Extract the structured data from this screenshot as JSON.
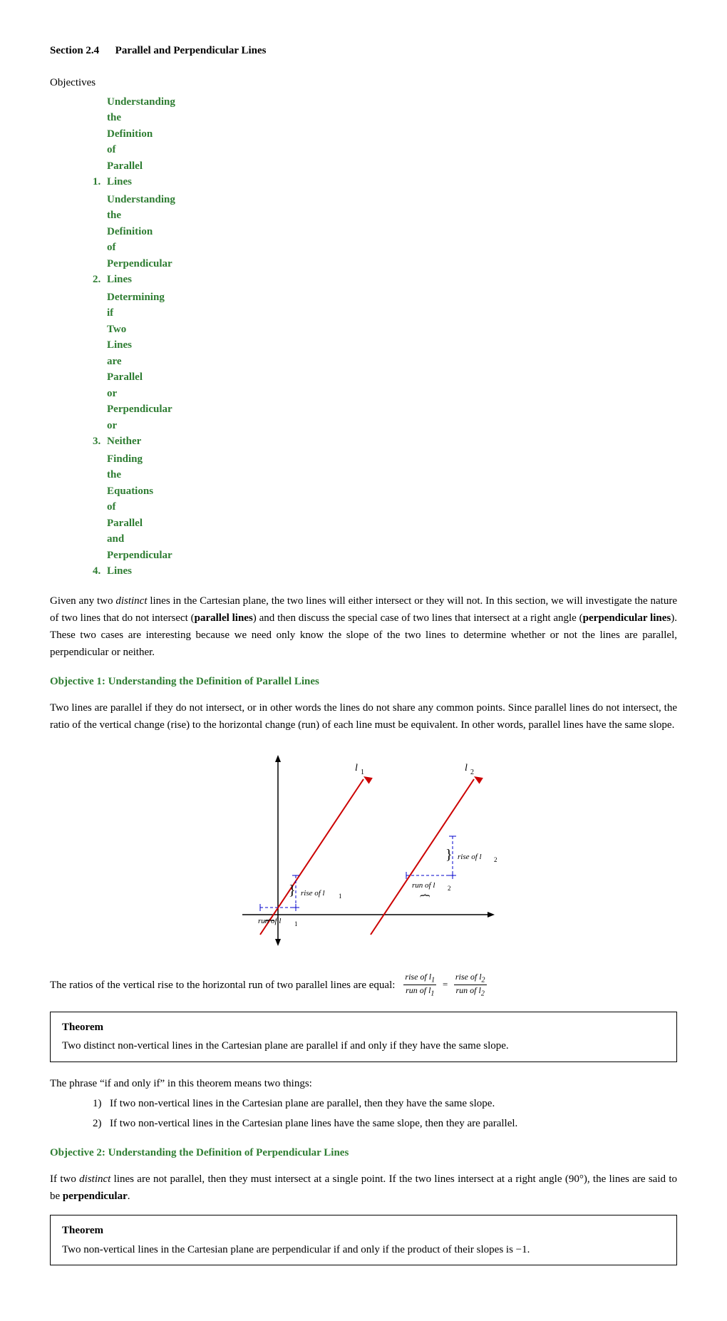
{
  "section": {
    "number": "Section 2.4",
    "title": "Parallel and Perpendicular Lines"
  },
  "objectives_label": "Objectives",
  "objectives": [
    {
      "num": "1.",
      "text": "Understanding the Definition of Parallel Lines"
    },
    {
      "num": "2.",
      "text": "Understanding the Definition of Perpendicular Lines"
    },
    {
      "num": "3.",
      "text": "Determining if Two Lines are Parallel or Perpendicular or Neither"
    },
    {
      "num": "4.",
      "text": "Finding the Equations of Parallel and Perpendicular Lines"
    }
  ],
  "intro": "Given any two distinct lines in the Cartesian plane, the two lines will either intersect or they will not.  In this section, we will investigate the nature of two lines that do not intersect (parallel lines) and then discuss the special case of two lines that intersect at a right angle (perpendicular lines).  These two cases are interesting because we need only know the slope of the two lines to determine whether or not the lines are parallel, perpendicular or neither.",
  "obj1_heading": "Objective 1:  Understanding the Definition of Parallel Lines",
  "obj1_text": "Two lines are parallel if they do not intersect, or in other words the lines do not share any common points. Since parallel lines do not intersect, the ratio of the vertical change (rise) to the horizontal change (run) of each line must be equivalent.  In other words, parallel lines have the same slope.",
  "ratio_text": "The ratios of the vertical rise to the horizontal run of two parallel lines are equal:",
  "theorem1": {
    "title": "Theorem",
    "text": "Two distinct non-vertical lines in the Cartesian plane are parallel if and only if they have the same slope."
  },
  "if_and_only_text": "The phrase “if and only if” in this theorem means two things:",
  "if_and_only_list": [
    "If two non-vertical lines in the Cartesian plane are parallel, then they have the same slope.",
    "If two non-vertical lines in the Cartesian plane lines have the same slope, then they are parallel."
  ],
  "obj2_heading": "Objective 2:  Understanding the Definition of Perpendicular Lines",
  "obj2_text1": "If two distinct lines are not parallel, then they must intersect at a single point.  If the two lines intersect at a right angle",
  "obj2_angle": "(90°)",
  "obj2_text2": ", the lines are said to be perpendicular.",
  "theorem2": {
    "title": "Theorem",
    "text": "Two non-vertical lines in the Cartesian plane are perpendicular if and only if the product of their slopes is −1."
  }
}
